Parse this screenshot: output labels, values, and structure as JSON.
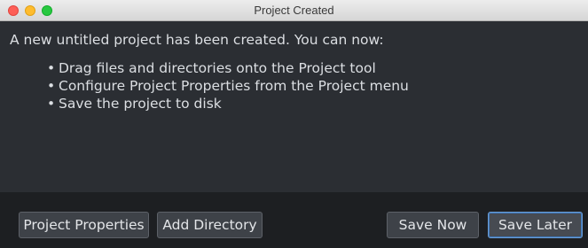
{
  "window": {
    "title": "Project Created"
  },
  "message": {
    "intro": "A new untitled project has been created. You can now:",
    "bullets": [
      "Drag files and directories onto the Project tool",
      "Configure Project Properties from the Project menu",
      "Save the project to disk"
    ],
    "bullet_glyph": "•"
  },
  "buttons": {
    "project_properties": "Project Properties",
    "add_directory": "Add Directory",
    "save_now": "Save Now",
    "save_later": "Save Later"
  },
  "colors": {
    "background": "#2b2e33",
    "button_bar": "#1d1f22",
    "default_button_focus": "#6b9bd1"
  }
}
